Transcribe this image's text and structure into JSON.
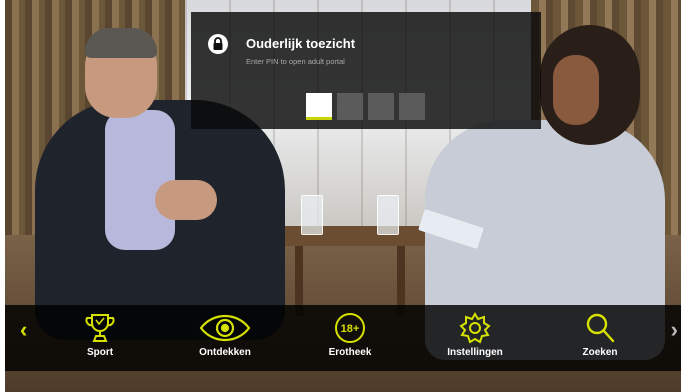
{
  "pin_dialog": {
    "title": "Ouderlijk toezicht",
    "subtitle": "Enter PIN to open adult portal",
    "digits_total": 4,
    "active_index": 0
  },
  "menu": {
    "items": [
      {
        "label": "Sport",
        "icon": "trophy-icon"
      },
      {
        "label": "Ontdekken",
        "icon": "eye-icon"
      },
      {
        "label": "Erotheek",
        "icon": "18-plus-icon"
      },
      {
        "label": "Instellingen",
        "icon": "gear-icon"
      },
      {
        "label": "Zoeken",
        "icon": "search-icon"
      }
    ],
    "left_arrow": "‹",
    "right_arrow": "›"
  },
  "colors": {
    "accent": "#d7e100",
    "overlay": "#0a0a0a",
    "pin_empty": "#5b5b5b"
  }
}
